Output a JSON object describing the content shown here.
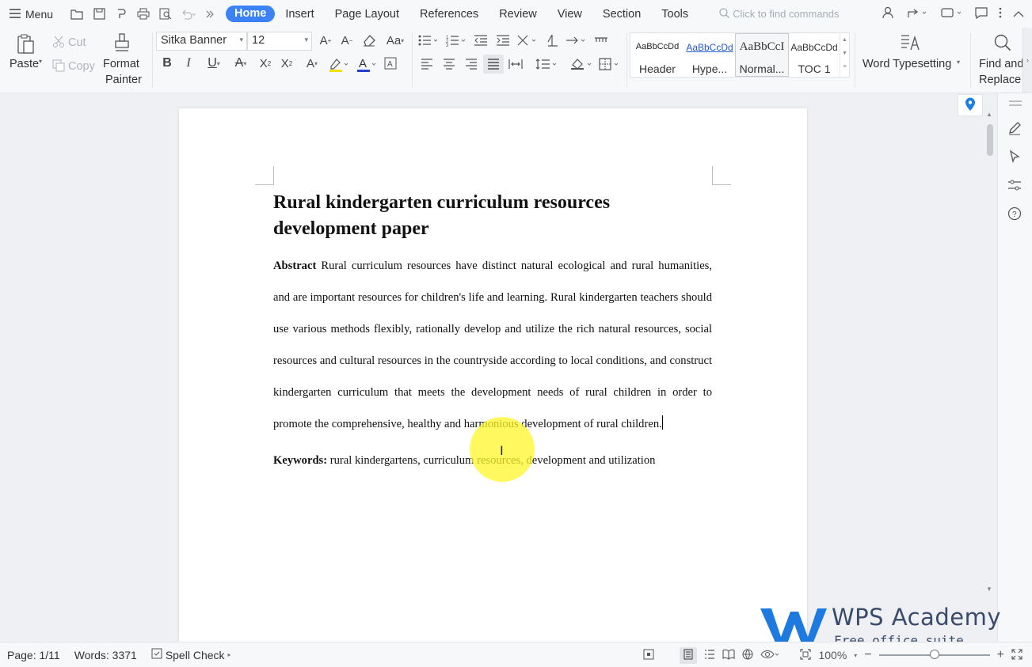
{
  "menubar": {
    "menu_label": "Menu",
    "tabs": [
      {
        "label": "Home",
        "active": true
      },
      {
        "label": "Insert"
      },
      {
        "label": "Page Layout"
      },
      {
        "label": "References"
      },
      {
        "label": "Review"
      },
      {
        "label": "View"
      },
      {
        "label": "Section"
      },
      {
        "label": "Tools"
      }
    ],
    "find_placeholder": "Click to find commands"
  },
  "ribbon": {
    "paste": "Paste",
    "cut": "Cut",
    "copy": "Copy",
    "format_painter_1": "Format",
    "format_painter_2": "Painter",
    "font_name": "Sitka Banner",
    "font_size": "12",
    "styles": [
      {
        "preview": "AaBbCcDd",
        "name": "Header"
      },
      {
        "preview": "AaBbCcDd",
        "name": "Hype..."
      },
      {
        "preview": "AaBbCcI",
        "name": "Normal..."
      },
      {
        "preview": "AaBbCcDd",
        "name": "TOC 1"
      }
    ],
    "word_typesetting": "Word Typesetting",
    "find_replace_1": "Find and",
    "find_replace_2": "Replace"
  },
  "document": {
    "title_line1": "Rural kindergarten curriculum resources",
    "title_line2": "development paper",
    "abstract_label": "Abstract",
    "abstract_text": "Rural curriculum resources have distinct natural ecological and rural humanities, and are important resources for children's life and learning. Rural kindergarten teachers should use various methods flexibly, rationally develop and utilize the rich natural resources, social resources and cultural resources in the countryside according to local conditions, and construct kindergarten curriculum that meets the development needs of rural children in order to promote the comprehensive, healthy and harmonious development of rural children.",
    "keywords_label": "Keywords:",
    "keywords_text": "rural kindergartens, curriculum resources, development and utilization"
  },
  "watermark": {
    "title": "WPS Academy",
    "subtitle": "Free office suite tutorials"
  },
  "statusbar": {
    "page": "Page: 1/11",
    "words": "Words: 3371",
    "spell_check": "Spell Check",
    "zoom": "100%",
    "zoom_fraction": 0.5
  },
  "colors": {
    "accent": "#3b82f6",
    "highlight": "#fff528",
    "location_pin": "#1a7de0"
  }
}
